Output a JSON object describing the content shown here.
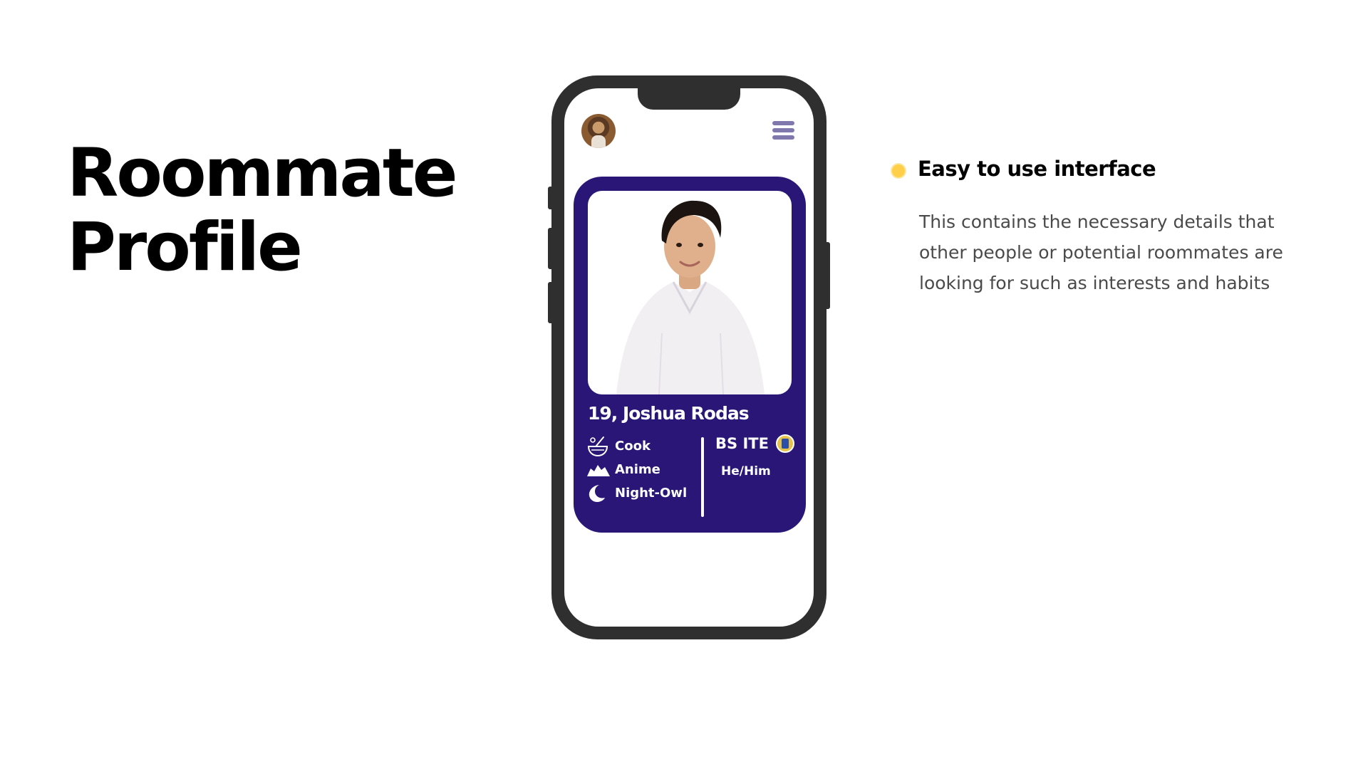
{
  "slide": {
    "title_line1": "Roommate",
    "title_line2": "Profile"
  },
  "phone": {
    "header": {
      "avatar_icon": "avatar-photo",
      "menu_icon": "hamburger-menu-icon",
      "menu_color": "#7f78ac"
    },
    "profile_card": {
      "background_color": "#2a1677",
      "name": "19, Joshua Rodas",
      "interests": [
        {
          "label": "Cook",
          "icon": "cooking-bowl-icon"
        },
        {
          "label": "Anime",
          "icon": "anime-icon"
        },
        {
          "label": "Night-Owl",
          "icon": "crescent-moon-icon"
        }
      ],
      "degree": "BS ITE",
      "school_icon": "school-seal-icon",
      "pronouns": "He/Him"
    }
  },
  "feature": {
    "bullet_color": "#ffcf4a",
    "heading": "Easy to use interface",
    "description": "This contains the necessary details that other people or potential roommates are looking for such as interests and habits"
  }
}
